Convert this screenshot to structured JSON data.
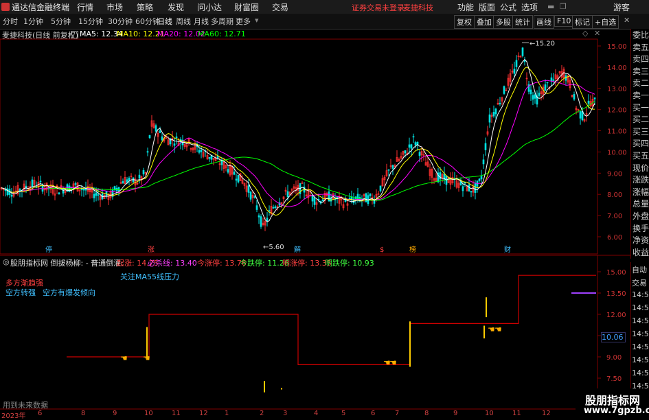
{
  "titlebar": {
    "app": "通达信金融终端",
    "menus": [
      "行情",
      "市场",
      "策略",
      "发现",
      "问小达",
      "财富圈",
      "交易"
    ],
    "warning": "证券交易未登录",
    "stock": "麦捷科技",
    "right": [
      "功能",
      "版面",
      "公式",
      "选项"
    ],
    "guest": "游客"
  },
  "periods": [
    "分时",
    "1分钟",
    "5分钟",
    "15分钟",
    "30分钟",
    "60分钟",
    "日线",
    "周线",
    "月线",
    "多周期",
    "更多"
  ],
  "active_period": "日线",
  "tools": [
    "复权",
    "叠加",
    "多股",
    "统计",
    "画线",
    "F10",
    "标记",
    "+自选"
  ],
  "main_legend": {
    "title": "麦捷科技(日线 前复权)",
    "ma5": "MA5: 12.34",
    "ma10": "MA10: 12.21",
    "ma20": "MA20: 12.02",
    "ma60": "MA60: 12.71",
    "colors": {
      "ma5": "#ffffff",
      "ma10": "#ffff00",
      "ma20": "#ff00ff",
      "ma60": "#00ff00"
    }
  },
  "price_axis": [
    "15.00",
    "14.00",
    "13.00",
    "12.00",
    "11.00",
    "10.00",
    "9.00",
    "8.00",
    "7.00",
    "6.00"
  ],
  "high_label": "15.20",
  "low_label": "5.60",
  "event_marks": [
    {
      "text": "停",
      "color": "#40c0ff"
    },
    {
      "text": "涨",
      "color": "#ff4040"
    },
    {
      "text": "解",
      "color": "#40c0ff"
    },
    {
      "text": "$",
      "color": "#ff4040"
    },
    {
      "text": "榜",
      "color": "#ffaa00"
    },
    {
      "text": "财",
      "color": "#40c0ff"
    }
  ],
  "side_panel": [
    "委比",
    "卖五",
    "卖四",
    "卖三",
    "卖二",
    "卖一",
    "买一",
    "买二",
    "买三",
    "买四",
    "买五",
    "现价",
    "涨跌",
    "涨幅",
    "总量",
    "外盘",
    "换手",
    "净资",
    "收益"
  ],
  "indicator": {
    "name": "股朋指标网 倒拔杨柳: - 普通倒灌:",
    "values": [
      {
        "label": "起涨: 14.75",
        "color": "#ff4040"
      },
      {
        "label": "必杀线: 13.40",
        "color": "#ff40ff"
      },
      {
        "label": "今涨停: 13.76",
        "color": "#ff4040"
      },
      {
        "label": "今跌停: 11.26",
        "color": "#40ff40"
      },
      {
        "label": "明涨停: 13.35",
        "color": "#ff4040"
      },
      {
        "label": "明跌停: 10.93",
        "color": "#40ff40"
      }
    ],
    "notes": [
      {
        "text": "关注MA55线压力",
        "color": "#40c0ff"
      },
      {
        "text": "多方渐趋强",
        "color": "#ff4040"
      },
      {
        "text": "空方转强",
        "color": "#40c0ff"
      },
      {
        "text": "空方有爆发倾向",
        "color": "#40c0ff"
      }
    ],
    "axis": [
      "15.00",
      "13.50",
      "12.00",
      "10.50",
      "9.00",
      "7.50"
    ],
    "current": "10.06",
    "footer": "用到未来数据"
  },
  "side2": [
    "自动",
    "交易",
    "14:56",
    "14:56",
    "14:56",
    "14:56",
    "14:56",
    "14:56",
    "14:56",
    "14:56",
    "14:56"
  ],
  "x_axis": [
    "2023年",
    "6",
    "8",
    "9",
    "10",
    "11",
    "12",
    "1",
    "2",
    "3",
    "4",
    "5",
    "6",
    "7",
    "8",
    "9",
    "10",
    "11",
    "12"
  ],
  "logo": {
    "main": "股朋指标网",
    "url": "www.7gpzb.com"
  }
}
